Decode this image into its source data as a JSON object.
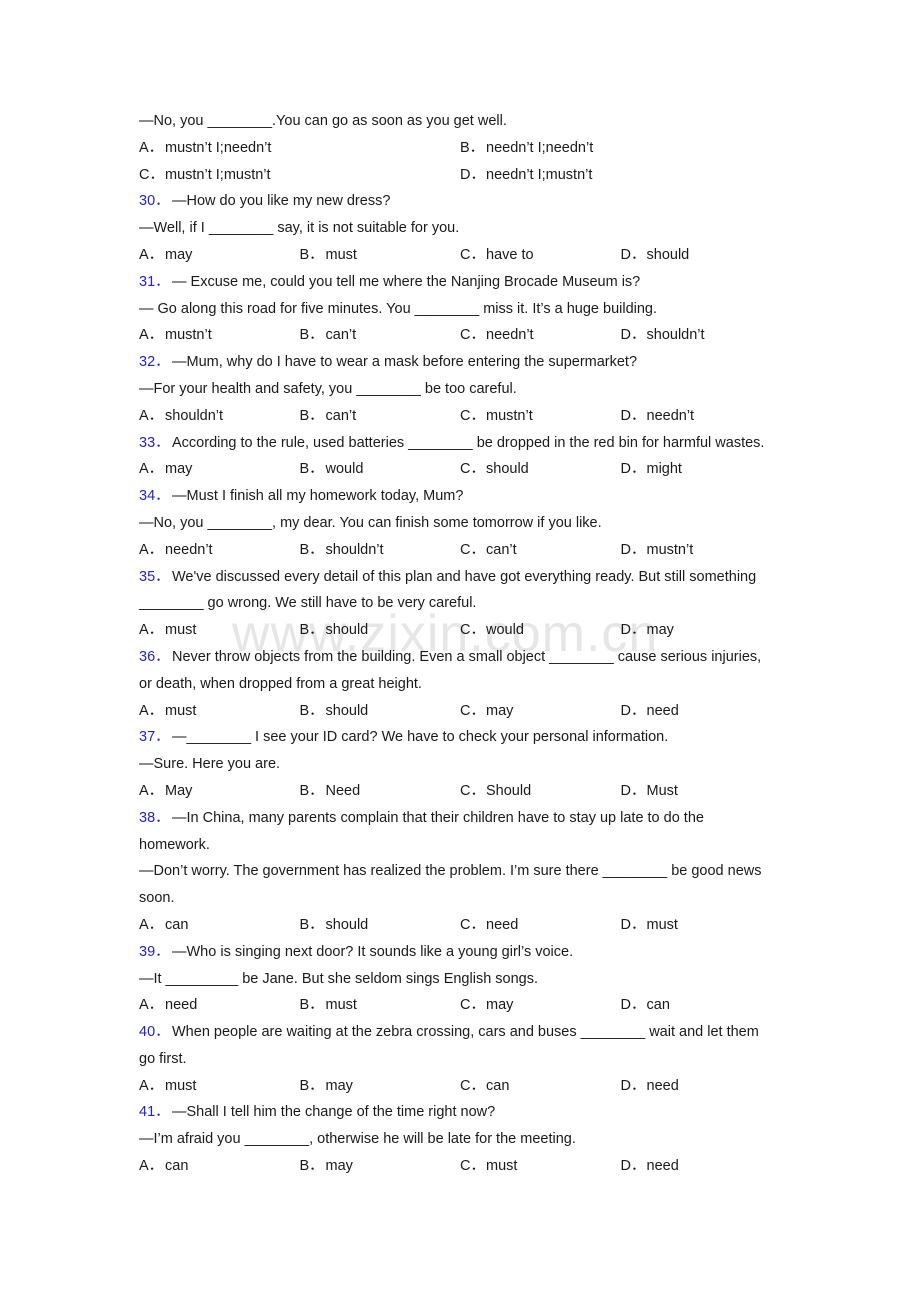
{
  "watermark": "www.zixin.com.cn",
  "intro": {
    "line": "—No, you ________.You can go as soon as you get well.",
    "options": [
      {
        "letter": "A．",
        "text": "mustn’t I;needn’t"
      },
      {
        "letter": "B．",
        "text": "needn’t I;needn’t"
      },
      {
        "letter": "C．",
        "text": "mustn’t I;mustn’t"
      },
      {
        "letter": "D．",
        "text": "needn’t I;mustn’t"
      }
    ]
  },
  "questions": [
    {
      "num": "30．",
      "lines": [
        "—How do you like my new dress?",
        "—Well, if I ________ say, it is not suitable for you."
      ],
      "options": [
        {
          "letter": "A．",
          "text": "may"
        },
        {
          "letter": "B．",
          "text": "must"
        },
        {
          "letter": "C．",
          "text": "have to"
        },
        {
          "letter": "D．",
          "text": "should"
        }
      ]
    },
    {
      "num": "31．",
      "lines": [
        "— Excuse me, could you tell me where the Nanjing Brocade Museum is?",
        "— Go along this road for five minutes. You ________ miss it. It’s a huge building."
      ],
      "options": [
        {
          "letter": "A．",
          "text": "mustn’t"
        },
        {
          "letter": "B．",
          "text": "can’t"
        },
        {
          "letter": "C．",
          "text": "needn’t"
        },
        {
          "letter": "D．",
          "text": "shouldn’t"
        }
      ]
    },
    {
      "num": "32．",
      "lines": [
        "—Mum, why do I have to wear a mask before entering the supermarket?",
        "—For your health and safety, you ________ be too careful."
      ],
      "options": [
        {
          "letter": "A．",
          "text": "shouldn’t"
        },
        {
          "letter": "B．",
          "text": "can’t"
        },
        {
          "letter": "C．",
          "text": "mustn’t"
        },
        {
          "letter": "D．",
          "text": "needn’t"
        }
      ]
    },
    {
      "num": "33．",
      "lines": [
        "According to the rule, used batteries ________ be dropped in the red bin for harmful wastes."
      ],
      "options": [
        {
          "letter": "A．",
          "text": "may"
        },
        {
          "letter": "B．",
          "text": "would"
        },
        {
          "letter": "C．",
          "text": "should"
        },
        {
          "letter": "D．",
          "text": "might"
        }
      ]
    },
    {
      "num": "34．",
      "lines": [
        "—Must I finish all my homework today, Mum?",
        "—No, you ________, my dear. You can finish some tomorrow if you like."
      ],
      "options": [
        {
          "letter": "A．",
          "text": "needn’t"
        },
        {
          "letter": "B．",
          "text": "shouldn’t"
        },
        {
          "letter": "C．",
          "text": "can’t"
        },
        {
          "letter": "D．",
          "text": "mustn’t"
        }
      ]
    },
    {
      "num": "35．",
      "lines": [
        "We've discussed every detail of this plan and have got everything ready. But still something",
        "________ go wrong. We still have to be very careful."
      ],
      "options": [
        {
          "letter": "A．",
          "text": "must"
        },
        {
          "letter": "B．",
          "text": "should"
        },
        {
          "letter": "C．",
          "text": "would"
        },
        {
          "letter": "D．",
          "text": "may"
        }
      ]
    },
    {
      "num": "36．",
      "lines": [
        "Never throw objects from the building. Even a small object ________ cause serious injuries,",
        "or death, when dropped from a great height."
      ],
      "options": [
        {
          "letter": "A．",
          "text": "must"
        },
        {
          "letter": "B．",
          "text": "should"
        },
        {
          "letter": "C．",
          "text": "may"
        },
        {
          "letter": "D．",
          "text": "need"
        }
      ]
    },
    {
      "num": "37．",
      "lines": [
        "—________ I see your ID card? We have to check your personal information.",
        "—Sure. Here you are."
      ],
      "options": [
        {
          "letter": "A．",
          "text": "May"
        },
        {
          "letter": "B．",
          "text": "Need"
        },
        {
          "letter": "C．",
          "text": "Should"
        },
        {
          "letter": "D．",
          "text": "Must"
        }
      ]
    },
    {
      "num": "38．",
      "lines": [
        "—In China, many parents complain that their children have to stay up late to do the",
        "homework.",
        "—Don’t worry. The government has realized the problem. I’m sure there ________ be good news",
        "soon."
      ],
      "options": [
        {
          "letter": "A．",
          "text": "can"
        },
        {
          "letter": "B．",
          "text": "should"
        },
        {
          "letter": "C．",
          "text": "need"
        },
        {
          "letter": "D．",
          "text": "must"
        }
      ]
    },
    {
      "num": "39．",
      "lines": [
        "—Who is singing next door? It sounds like a young girl’s voice.",
        "—It _________ be Jane. But she seldom sings English songs."
      ],
      "options": [
        {
          "letter": "A．",
          "text": "need"
        },
        {
          "letter": "B．",
          "text": "must"
        },
        {
          "letter": "C．",
          "text": "may"
        },
        {
          "letter": "D．",
          "text": "can"
        }
      ]
    },
    {
      "num": "40．",
      "lines": [
        "When people are waiting at the zebra crossing, cars and buses ________ wait and let them",
        "go first."
      ],
      "options": [
        {
          "letter": "A．",
          "text": "must"
        },
        {
          "letter": "B．",
          "text": "may"
        },
        {
          "letter": "C．",
          "text": "can"
        },
        {
          "letter": "D．",
          "text": "need"
        }
      ]
    },
    {
      "num": "41．",
      "lines": [
        "—Shall I tell him the change of the time right now?",
        "—I’m afraid you ________, otherwise he will be late for the meeting."
      ],
      "options": [
        {
          "letter": "A．",
          "text": "can"
        },
        {
          "letter": "B．",
          "text": "may"
        },
        {
          "letter": "C．",
          "text": "must"
        },
        {
          "letter": "D．",
          "text": "need"
        }
      ]
    }
  ]
}
